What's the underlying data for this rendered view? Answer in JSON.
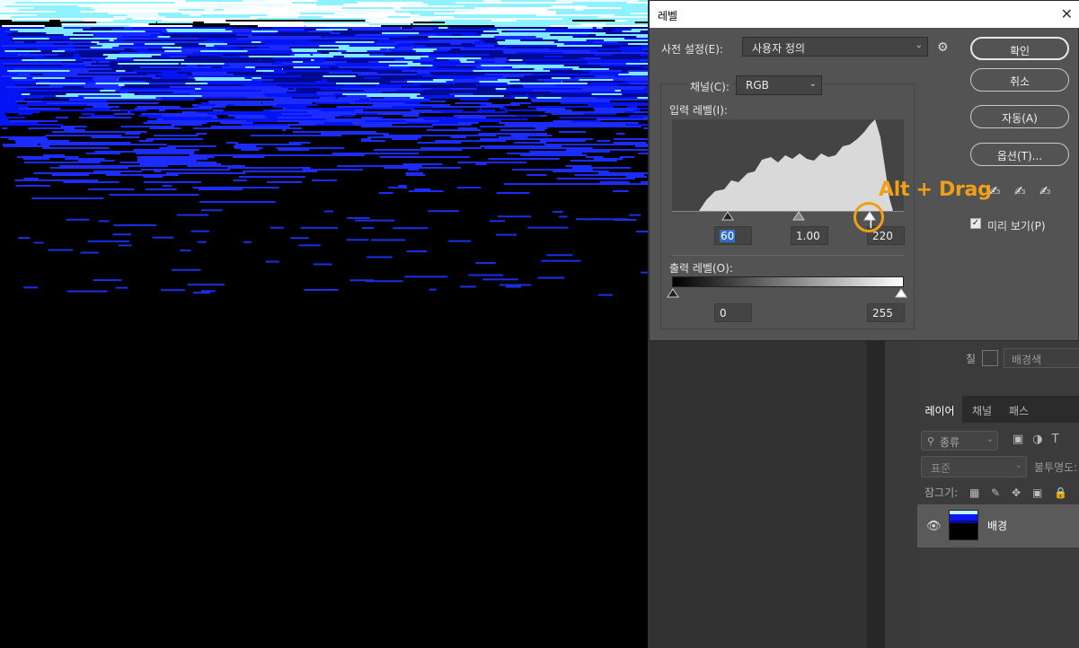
{
  "dialog": {
    "title": "레벨",
    "close_icon": "close-icon",
    "preset_label": "사전 설정(E):",
    "preset_value": "사용자 정의",
    "channel_label": "채널(C):",
    "channel_value": "RGB",
    "input_levels_label": "입력 레벨(I):",
    "input_black": "60",
    "input_gamma": "1.00",
    "input_white": "220",
    "output_levels_label": "출력 레벨(O):",
    "output_black": "0",
    "output_white": "255",
    "buttons": {
      "ok": "확인",
      "cancel": "취소",
      "auto": "자동(A)",
      "options": "옵션(T)..."
    },
    "preview_label": "미리 보기(P)",
    "preview_checked": true
  },
  "annotation": {
    "text": "Alt + Drag",
    "color": "#f0a017"
  },
  "panel": {
    "fill_label": "칠",
    "fill_value": "배경색",
    "tabs": [
      "레이어",
      "채널",
      "패스"
    ],
    "search_placeholder": "종류",
    "blend_mode": "표준",
    "opacity_label": "불투명도:",
    "lock_label": "잠그기:",
    "fill_label2": "칠",
    "layer_name": "배경"
  }
}
